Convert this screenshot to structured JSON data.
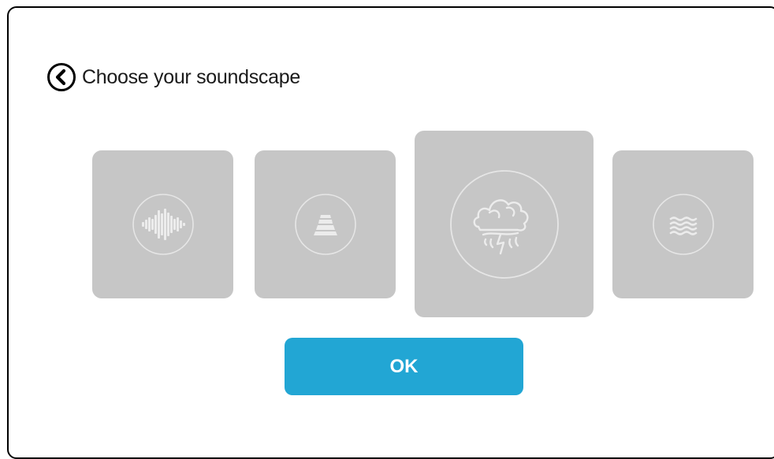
{
  "header": {
    "title": "Choose your soundscape",
    "back_icon": "chevron-left-circle-icon"
  },
  "soundscapes": [
    {
      "icon": "sound-wave-icon",
      "selected": false
    },
    {
      "icon": "road-icon",
      "selected": false
    },
    {
      "icon": "storm-cloud-icon",
      "selected": true
    },
    {
      "icon": "ocean-waves-icon",
      "selected": false
    }
  ],
  "ok_button": {
    "label": "OK"
  },
  "colors": {
    "card_background": "#c6c6c6",
    "icon_line": "#e6e6e6",
    "accent": "#22a6d4",
    "frame_border": "#000000"
  }
}
